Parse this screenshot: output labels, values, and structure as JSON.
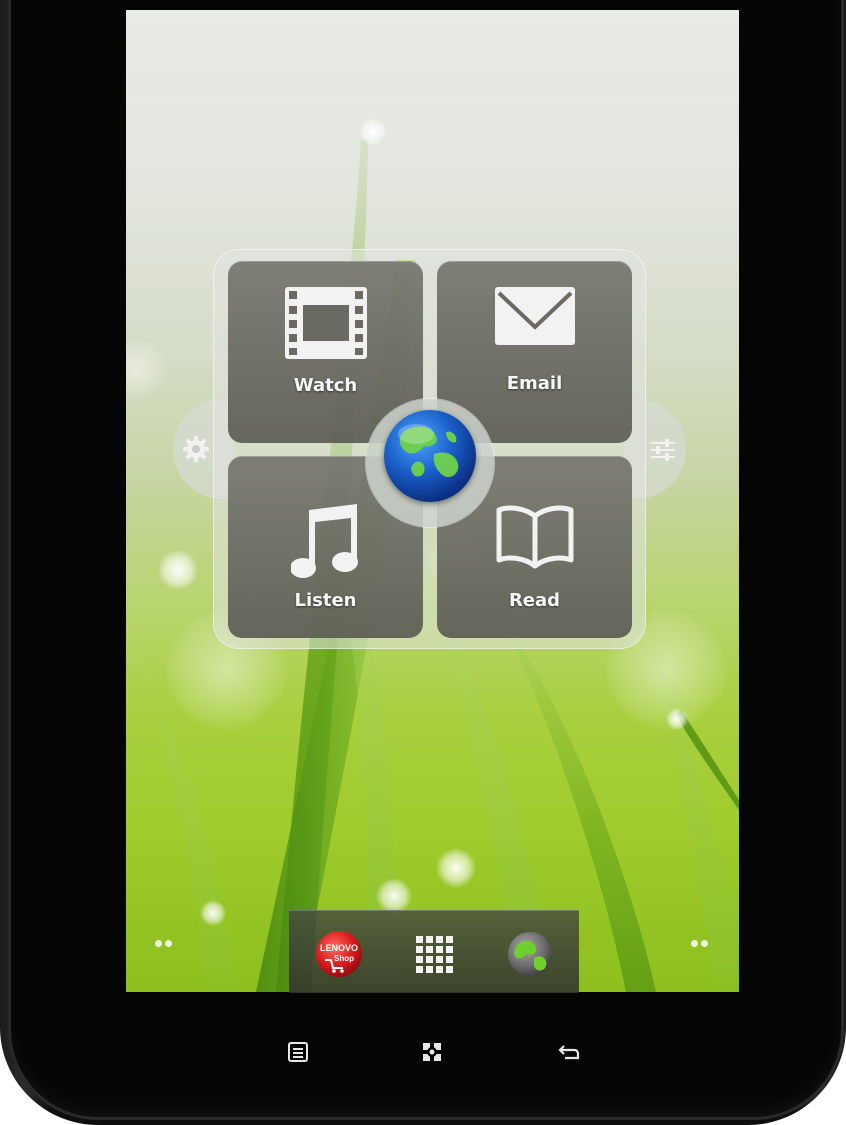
{
  "widget": {
    "tiles": [
      {
        "label": "Watch",
        "icon": "film-icon"
      },
      {
        "label": "Email",
        "icon": "envelope-icon"
      },
      {
        "label": "Listen",
        "icon": "music-note-icon"
      },
      {
        "label": "Read",
        "icon": "open-book-icon"
      }
    ],
    "center_icon": "globe-icon",
    "left_icon": "gear-icon",
    "right_icon": "sliders-icon"
  },
  "dock": {
    "items": [
      {
        "icon": "lenovo-shop-icon",
        "text_line1": "LENOVO",
        "text_line2": "Shop"
      },
      {
        "icon": "app-grid-icon"
      },
      {
        "icon": "browser-globe-icon"
      }
    ]
  },
  "hardware_keys": [
    {
      "icon": "menu-icon"
    },
    {
      "icon": "home-icon"
    },
    {
      "icon": "back-icon"
    }
  ],
  "colors": {
    "tile_bg": "#5c5c54",
    "dock_bg": "#32342d",
    "bezel": "#050505",
    "lenovo_red": "#d8191c"
  }
}
